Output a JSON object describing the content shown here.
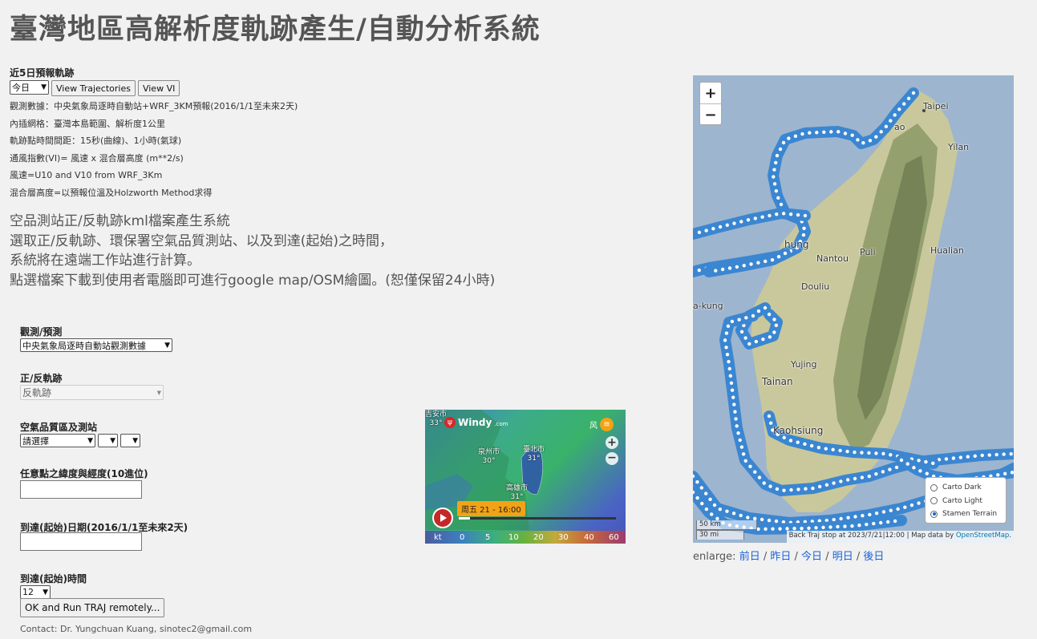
{
  "title": "臺灣地區高解析度軌跡產生/自動分析系統",
  "forecast": {
    "heading": "近5日預報軌跡",
    "day_select": "今日",
    "view_traj_label": "View Trajectories",
    "view_vi_label": "View VI"
  },
  "info_lines": [
    "觀測數據：中央氣象局逐時自動站+WRF_3KM預報(2016/1/1至未來2天)",
    "內插網格：臺灣本島範圍、解析度1公里",
    "軌跡點時間間距：15秒(曲線)、1小時(氣球)",
    "通風指數(VI)= 風速 x 混合層高度 (m**2/s)",
    "風速=U10 and V10 from WRF_3Km",
    "混合層高度=以預報位溫及Holzworth Method求得"
  ],
  "description": [
    "空品測站正/反軌跡kml檔案產生系統",
    "選取正/反軌跡、環保署空氣品質測站、以及到達(起始)之時間，",
    "系統將在遠端工作站進行計算。",
    "點選檔案下載到使用者電腦即可進行google map/OSM繪圖。(恕僅保留24小時)"
  ],
  "form": {
    "obs_label": "觀測/預測",
    "obs_value": "中央氣象局逐時自動站觀測數據",
    "direction_label": "正/反軌跡",
    "direction_value": "反軌跡",
    "station_label": "空氣品質區及測站",
    "station_value": "請選擇",
    "latlon_label": "任意點之緯度與經度(10進位)",
    "latlon_value": "",
    "date_label": "到達(起始)日期(2016/1/1至未來2天)",
    "date_value": "",
    "time_label": "到達(起始)時間",
    "time_value": "12",
    "run_label": "OK and Run TRAJ remotely...",
    "contact": "Contact: Dr. Yungchuan Kuang, sinotec2@gmail.com"
  },
  "windy": {
    "logo": "Windy",
    "logo_suffix": ".com",
    "time_label": "周五 21 - 16:00",
    "wind_label": "风",
    "city_labels": [
      {
        "name": "吉安市",
        "temp": "33°"
      },
      {
        "name": "泉州市",
        "temp": "30°"
      },
      {
        "name": "臺北市",
        "temp": "31°"
      },
      {
        "name": "高雄市",
        "temp": "31°"
      }
    ],
    "legend": [
      "kt",
      "0",
      "5",
      "10",
      "20",
      "30",
      "40",
      "60"
    ]
  },
  "map": {
    "zoom_in": "+",
    "zoom_out": "−",
    "cities": [
      "Taipei",
      "Yilan",
      "Hualian",
      "Nantou",
      "Puli",
      "Douliu",
      "Yujing",
      "Tainan",
      "Kaohsiung",
      "a-kung",
      "hung",
      "ao"
    ],
    "layers": [
      {
        "label": "Carto Dark",
        "selected": false
      },
      {
        "label": "Carto Light",
        "selected": false
      },
      {
        "label": "Stamen Terrain",
        "selected": true
      }
    ],
    "scale_km": "50 km",
    "scale_mi": "30 mi",
    "attribution": "Back Traj stop at 2023/7/21|12:00 | Map data by ",
    "attribution_link": "OpenStreetMap",
    "colors": {
      "track": "#3b86d1",
      "water": "#9db5cf",
      "land": "#c9c89c"
    }
  },
  "enlarge": {
    "label": "enlarge:",
    "links": [
      "前日",
      "昨日",
      "今日",
      "明日",
      "後日"
    ]
  }
}
